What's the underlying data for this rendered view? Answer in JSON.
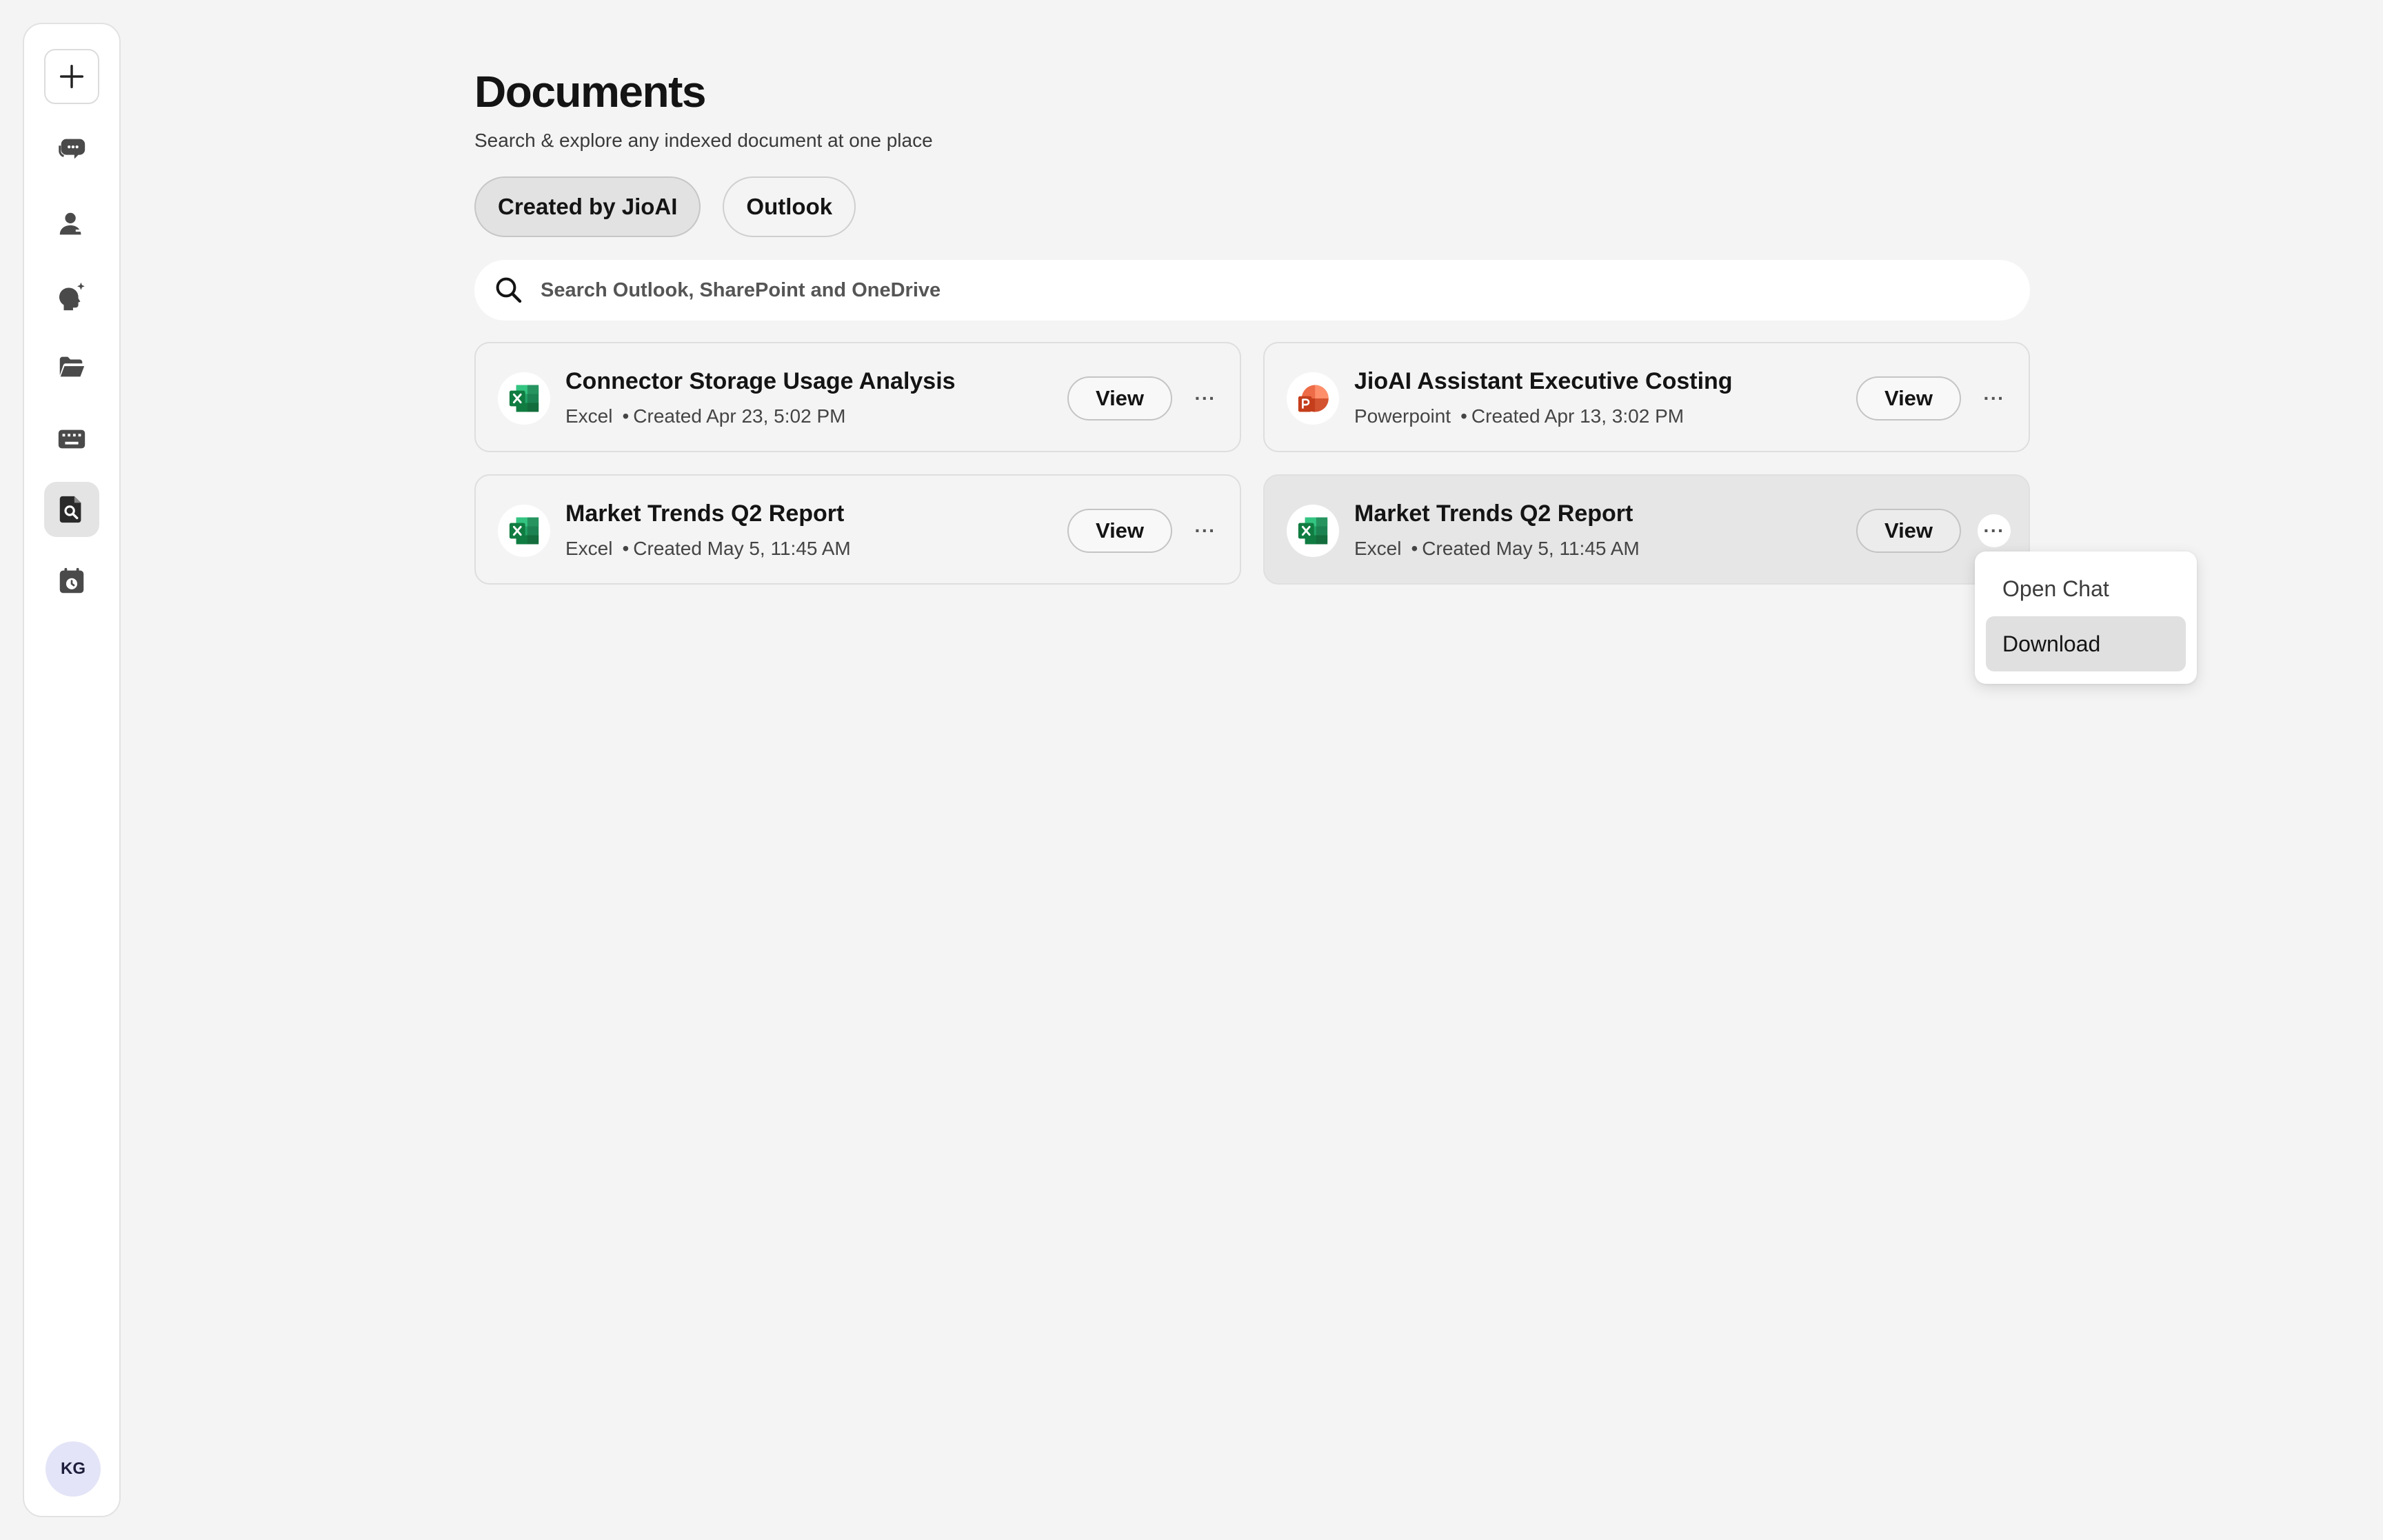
{
  "sidebar": {
    "items": [
      {
        "name": "new-chat",
        "icon": "plus-icon"
      },
      {
        "name": "chats",
        "icon": "chat-bubbles-icon"
      },
      {
        "name": "contacts",
        "icon": "person-icon"
      },
      {
        "name": "assistants",
        "icon": "sparkle-head-icon"
      },
      {
        "name": "files",
        "icon": "folder-icon"
      },
      {
        "name": "keyboard",
        "icon": "keyboard-icon"
      },
      {
        "name": "documents",
        "icon": "document-search-icon",
        "active": true
      },
      {
        "name": "schedule",
        "icon": "calendar-clock-icon"
      }
    ],
    "avatar_initials": "KG"
  },
  "header": {
    "title": "Documents",
    "subtitle": "Search & explore any indexed document at one place"
  },
  "tabs": [
    {
      "label": "Created by JioAI",
      "active": true
    },
    {
      "label": "Outlook",
      "active": false
    }
  ],
  "search": {
    "placeholder": "Search Outlook, SharePoint and OneDrive",
    "value": ""
  },
  "documents": [
    {
      "title": "Connector Storage Usage Analysis",
      "type": "Excel",
      "created": "Created Apr 23, 5:02 PM",
      "icon": "excel-icon"
    },
    {
      "title": "JioAI Assistant Executive Costing",
      "type": "Powerpoint",
      "created": "Created Apr 13, 3:02 PM",
      "icon": "powerpoint-icon"
    },
    {
      "title": "Market Trends Q2 Report",
      "type": "Excel",
      "created": "Created May 5, 11:45 AM",
      "icon": "excel-icon"
    },
    {
      "title": "Market Trends Q2 Report",
      "type": "Excel",
      "created": "Created May 5, 11:45 AM",
      "icon": "excel-icon"
    }
  ],
  "actions": {
    "view_label": "View",
    "more_label": "···",
    "separator": "•"
  },
  "menu": {
    "items": [
      {
        "label": "Open Chat",
        "highlighted": false
      },
      {
        "label": "Download",
        "highlighted": true
      }
    ]
  },
  "colors": {
    "background": "#f4f4f4",
    "excel_green": "#107c41",
    "powerpoint_red": "#d35230",
    "avatar_bg": "#e3e4f7"
  }
}
